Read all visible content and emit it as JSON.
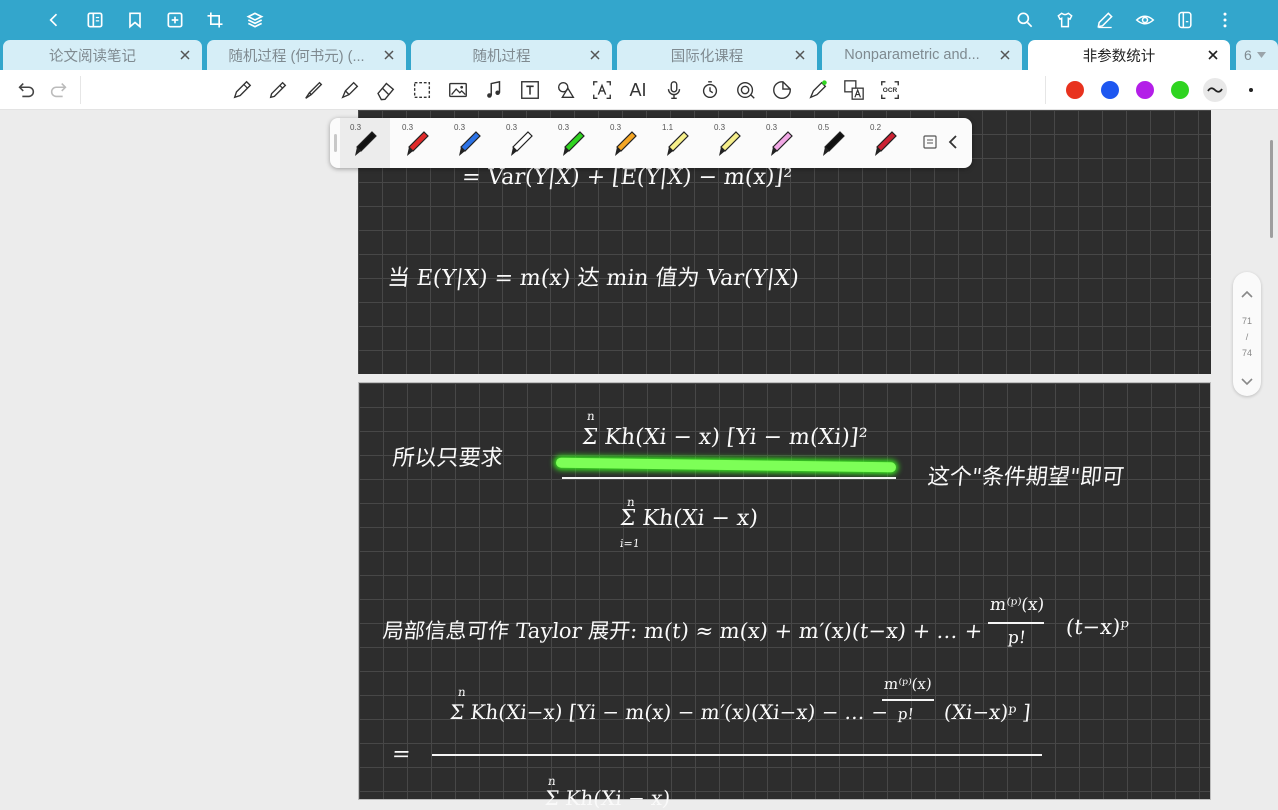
{
  "topbar": {
    "left_icons": [
      "back-icon",
      "notebook-icon",
      "bookmark-icon",
      "add-page-icon",
      "crop-icon",
      "layers-icon"
    ],
    "right_icons": [
      "search-icon",
      "shirt-icon",
      "pen-edit-icon",
      "eye-icon",
      "panel-icon",
      "more-vertical-icon"
    ]
  },
  "tabs": [
    {
      "label": "论文阅读笔记"
    },
    {
      "label": "随机过程 (何书元) (..."
    },
    {
      "label": "随机过程"
    },
    {
      "label": "国际化课程"
    },
    {
      "label": "Nonparametric and..."
    },
    {
      "label": "非参数统计"
    }
  ],
  "tab_overflow": {
    "count": "6"
  },
  "toolbar": {
    "ai_label": "AI",
    "ocr_label": "OCR",
    "tools": [
      "pencil-icon",
      "pen-icon",
      "fountain-pen-icon",
      "highlighter-icon",
      "eraser-icon",
      "lasso-select-icon",
      "image-icon",
      "music-icon",
      "text-box-icon",
      "shapes-icon",
      "text-recognition-icon",
      "ai-icon",
      "microphone-icon",
      "timer-icon",
      "record-icon",
      "sticker-icon",
      "laser-pointer-icon",
      "translate-icon",
      "ocr-icon"
    ],
    "colors": [
      "#e8321e",
      "#1e57f0",
      "#b31ee8",
      "#2fd420"
    ]
  },
  "pens": [
    {
      "width": "0.3",
      "color": "#111111"
    },
    {
      "width": "0.3",
      "color": "#e02a2a"
    },
    {
      "width": "0.3",
      "color": "#2b72e6"
    },
    {
      "width": "0.3",
      "color": "#ffffff"
    },
    {
      "width": "0.3",
      "color": "#2fd420"
    },
    {
      "width": "0.3",
      "color": "#f5a623"
    },
    {
      "width": "1.1",
      "color": "#f7f08a"
    },
    {
      "width": "0.3",
      "color": "#f5ee8a"
    },
    {
      "width": "0.3",
      "color": "#f2a9e6"
    },
    {
      "width": "0.5",
      "color": "#111111"
    },
    {
      "width": "0.2",
      "color": "#cc2233"
    }
  ],
  "page_counter": {
    "current": "71",
    "sep": "/",
    "total": "74"
  },
  "notes": {
    "line1": "= Var(Y|X) + [E(Y|X) − m(x)]²",
    "line2": "当 E(Y|X) = m(x) 达 min 值为 Var(Y|X)",
    "line3_label": "所以只要求",
    "line3_num": "Σ Kh(Xi − x) [Yi − m(Xi)]²",
    "line3_den": "Σ Kh(Xi − x)",
    "line3_sum_top": "n",
    "line3_sum_bottom": "i=1",
    "line3_tail": "这个\"条件期望\"即可",
    "line4": "局部信息可作 Taylor 展开:  m(t) ≈ m(x) + m′(x)(t−x) + … +",
    "line4_frac_num": "m⁽ᵖ⁾(x)",
    "line4_frac_den": "p!",
    "line4_tail": "(t−x)ᵖ",
    "line5_num": "Σ Kh(Xi−x) [Yi − m(x) − m′(x)(Xi−x) − … −",
    "line5_frac_num": "m⁽ᵖ⁾(x)",
    "line5_frac_den": "p!",
    "line5_tail": "(Xi−x)ᵖ ]",
    "line5_eq": "=",
    "line5_den": "Σ Kh(Xi − x)"
  }
}
